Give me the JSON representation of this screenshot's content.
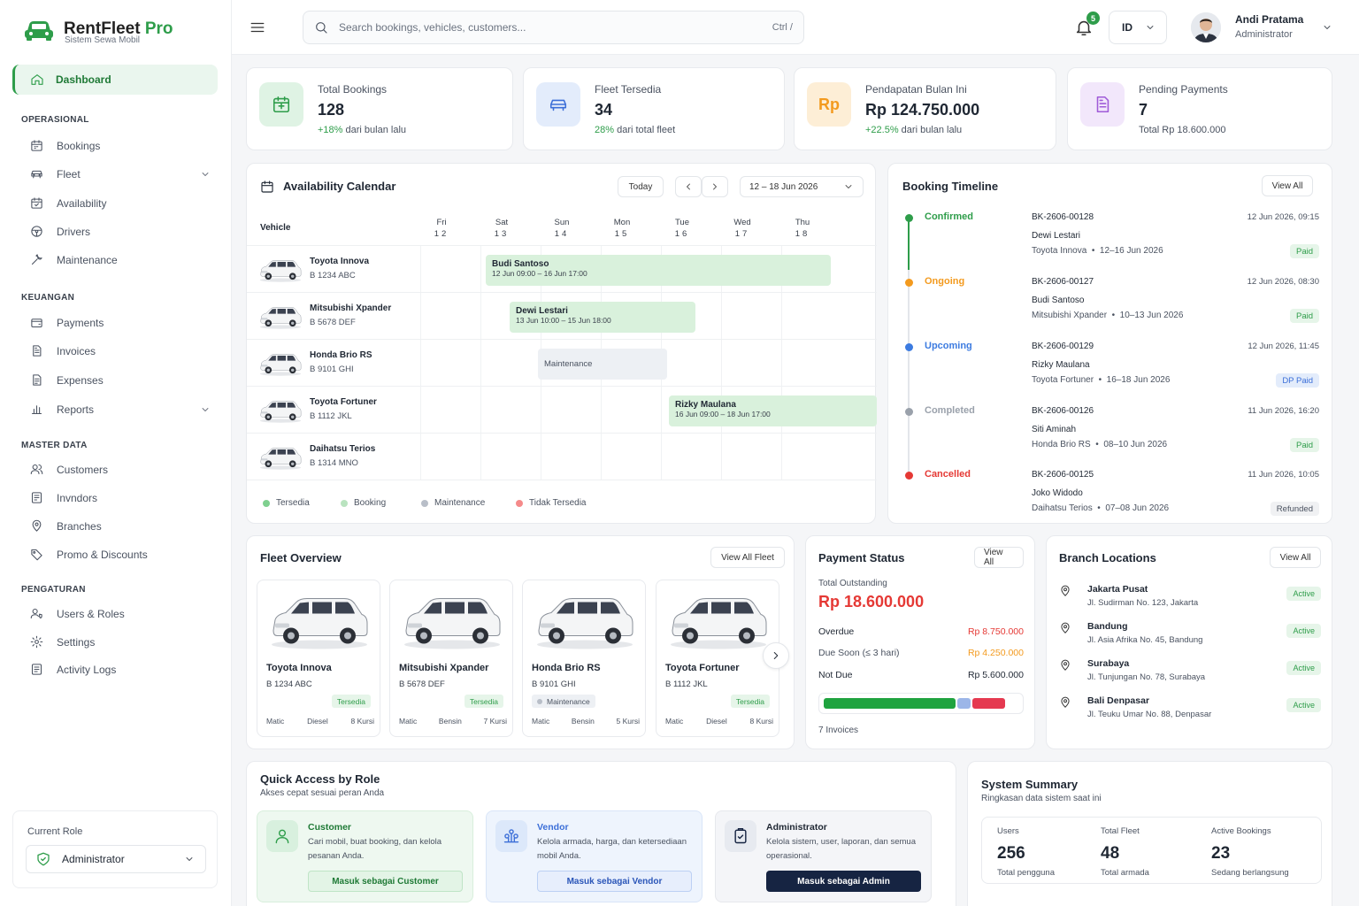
{
  "app": {
    "name": "RentFleet",
    "name_suffix": "Pro",
    "tagline": "Sistem Sewa Mobil"
  },
  "sidebar": {
    "dashboard": "Dashboard",
    "sections": {
      "operasional": "OPERASIONAL",
      "keuangan": "KEUANGAN",
      "master": "MASTER DATA",
      "pengaturan": "PENGATURAN"
    },
    "items": {
      "bookings": "Bookings",
      "fleet": "Fleet",
      "availability": "Availability",
      "drivers": "Drivers",
      "maintenance": "Maintenance",
      "payments": "Payments",
      "invoices": "Invoices",
      "expenses": "Expenses",
      "reports": "Reports",
      "customers": "Customers",
      "invndors": "Invndors",
      "branches": "Branches",
      "promo": "Promo & Discounts",
      "users": "Users & Roles",
      "settings": "Settings",
      "logs": "Activity Logs"
    },
    "role_label": "Current Role",
    "role_value": "Administrator"
  },
  "topbar": {
    "search_placeholder": "Search bookings, vehicles, customers...",
    "search_shortcut": "Ctrl /",
    "notif_count": "5",
    "lang": "ID",
    "user_name": "Andi Pratama",
    "user_role": "Administrator"
  },
  "stats": [
    {
      "title": "Total Bookings",
      "value": "128",
      "sub_hl": "+18%",
      "sub": " dari bulan lalu",
      "icon": "calendar-icon",
      "color": "#2e9d4a",
      "bg": "#dff3e4"
    },
    {
      "title": "Fleet Tersedia",
      "value": "34",
      "sub_hl": "28%",
      "sub": " dari total fleet",
      "icon": "car-icon",
      "color": "#3c6fd8",
      "bg": "#e3ecfb"
    },
    {
      "title": "Pendapatan Bulan Ini",
      "value": "Rp 124.750.000",
      "sub_hl": "+22.5%",
      "sub": " dari bulan lalu",
      "icon": "rupiah-icon",
      "color": "#f39a1e",
      "bg": "#fdeed6"
    },
    {
      "title": "Pending Payments",
      "value": "7",
      "sub_hl": "",
      "sub": "Total Rp 18.600.000",
      "icon": "document-icon",
      "color": "#a05bd8",
      "bg": "#f2e7fb"
    }
  ],
  "calendar": {
    "title": "Availability Calendar",
    "today": "Today",
    "range": "12 – 18 Jun 2026",
    "vehicle_col": "Vehicle",
    "days": [
      {
        "d": "Fri",
        "n": "12"
      },
      {
        "d": "Sat",
        "n": "13"
      },
      {
        "d": "Sun",
        "n": "14"
      },
      {
        "d": "Mon",
        "n": "15"
      },
      {
        "d": "Tue",
        "n": "16"
      },
      {
        "d": "Wed",
        "n": "17"
      },
      {
        "d": "Thu",
        "n": "18"
      }
    ],
    "vehicles": [
      {
        "name": "Toyota Innova",
        "plate": "B 1234 ABC"
      },
      {
        "name": "Mitsubishi Xpander",
        "plate": "B 5678 DEF"
      },
      {
        "name": "Honda Brio RS",
        "plate": "B 9101 GHI"
      },
      {
        "name": "Toyota Fortuner",
        "plate": "B 1112 JKL"
      },
      {
        "name": "Daihatsu Terios",
        "plate": "B 1314 MNO"
      }
    ],
    "bookings": [
      {
        "name": "Budi Santoso",
        "time": "12 Jun 09:00 – 16 Jun 17:00"
      },
      {
        "name": "Dewi Lestari",
        "time": "13 Jun 10:00 – 15 Jun 18:00"
      },
      {
        "name": "Maintenance",
        "time": ""
      },
      {
        "name": "Rizky Maulana",
        "time": "16 Jun 09:00 – 18 Jun 17:00"
      }
    ],
    "legend": [
      {
        "label": "Tersedia",
        "color": "#7fd08f"
      },
      {
        "label": "Booking",
        "color": "#b9e3bf"
      },
      {
        "label": "Maintenance",
        "color": "#b8bec8"
      },
      {
        "label": "Tidak Tersedia",
        "color": "#f58a8a"
      }
    ]
  },
  "timeline": {
    "title": "Booking Timeline",
    "view_all": "View All",
    "items": [
      {
        "status": "Confirmed",
        "color": "#2e9d4a",
        "id": "BK-2606-00128",
        "date": "12 Jun 2026, 09:15",
        "name": "Dewi Lestari",
        "car": "Toyota Innova",
        "period": "12–16 Jun 2026",
        "pay": "Paid",
        "pay_fg": "#2e9d4a",
        "pay_bg": "#e6f5e9"
      },
      {
        "status": "Ongoing",
        "color": "#f39a1e",
        "id": "BK-2606-00127",
        "date": "12 Jun 2026, 08:30",
        "name": "Budi Santoso",
        "car": "Mitsubishi Xpander",
        "period": "10–13 Jun 2026",
        "pay": "Paid",
        "pay_fg": "#2e9d4a",
        "pay_bg": "#e6f5e9"
      },
      {
        "status": "Upcoming",
        "color": "#3c7be0",
        "id": "BK-2606-00129",
        "date": "12 Jun 2026, 11:45",
        "name": "Rizky Maulana",
        "car": "Toyota Fortuner",
        "period": "16–18 Jun 2026",
        "pay": "DP Paid",
        "pay_fg": "#3c6fd8",
        "pay_bg": "#e3ecfb"
      },
      {
        "status": "Completed",
        "color": "#9aa1ab",
        "id": "BK-2606-00126",
        "date": "11 Jun 2026, 16:20",
        "name": "Siti Aminah",
        "car": "Honda Brio RS",
        "period": "08–10 Jun 2026",
        "pay": "Paid",
        "pay_fg": "#2e9d4a",
        "pay_bg": "#e6f5e9"
      },
      {
        "status": "Cancelled",
        "color": "#e53935",
        "id": "BK-2606-00125",
        "date": "11 Jun 2026, 10:05",
        "name": "Joko Widodo",
        "car": "Daihatsu Terios",
        "period": "07–08 Jun 2026",
        "pay": "Refunded",
        "pay_fg": "#4a5260",
        "pay_bg": "#f0f1f3"
      }
    ]
  },
  "fleet": {
    "title": "Fleet Overview",
    "view_all": "View All Fleet",
    "cars": [
      {
        "name": "Toyota Innova",
        "plate": "B 1234 ABC",
        "status": "Tersedia",
        "trans": "Matic",
        "fuel": "Diesel",
        "seats": "8 Kursi"
      },
      {
        "name": "Mitsubishi Xpander",
        "plate": "B 5678 DEF",
        "status": "Tersedia",
        "trans": "Matic",
        "fuel": "Bensin",
        "seats": "7 Kursi"
      },
      {
        "name": "Honda Brio RS",
        "plate": "B 9101 GHI",
        "status": "Maintenance",
        "trans": "Matic",
        "fuel": "Bensin",
        "seats": "5 Kursi"
      },
      {
        "name": "Toyota Fortuner",
        "plate": "B 1112 JKL",
        "status": "Tersedia",
        "trans": "Matic",
        "fuel": "Diesel",
        "seats": "8 Kursi"
      }
    ]
  },
  "payment": {
    "title": "Payment Status",
    "view_all": "View All",
    "outstanding_label": "Total Outstanding",
    "outstanding": "Rp 18.600.000",
    "rows": [
      {
        "label": "Overdue",
        "value": "Rp 8.750.000",
        "color": "#e53935"
      },
      {
        "label": "Due Soon (≤ 3 hari)",
        "value": "Rp 4.250.000",
        "color": "#f39a1e"
      },
      {
        "label": "Not Due",
        "value": "Rp 5.600.000",
        "color": "#1f2733"
      }
    ],
    "bar": [
      {
        "share": 0.69,
        "color": "#1fa33f"
      },
      {
        "share": 0.07,
        "color": "#9cb6e8"
      },
      {
        "share": 0.17,
        "color": "#e53950"
      }
    ],
    "invoices": "7 Invoices"
  },
  "branches": {
    "title": "Branch Locations",
    "view_all": "View All",
    "items": [
      {
        "name": "Jakarta Pusat",
        "addr": "Jl. Sudirman No. 123, Jakarta",
        "status": "Active"
      },
      {
        "name": "Bandung",
        "addr": "Jl. Asia Afrika No. 45, Bandung",
        "status": "Active"
      },
      {
        "name": "Surabaya",
        "addr": "Jl. Tunjungan No. 78, Surabaya",
        "status": "Active"
      },
      {
        "name": "Bali Denpasar",
        "addr": "Jl. Teuku Umar No. 88, Denpasar",
        "status": "Active"
      }
    ]
  },
  "quick": {
    "title": "Quick Access by Role",
    "subtitle": "Akses cepat sesuai peran Anda",
    "roles": [
      {
        "title": "Customer",
        "desc": "Cari mobil, buat booking, dan kelola pesanan Anda.",
        "btn": "Masuk sebagai Customer"
      },
      {
        "title": "Vendor",
        "desc": "Kelola armada, harga, dan ketersediaan mobil Anda.",
        "btn": "Masuk sebagai Vendor"
      },
      {
        "title": "Administrator",
        "desc": "Kelola sistem, user, laporan, dan semua operasional.",
        "btn": "Masuk sebagai Admin"
      }
    ]
  },
  "summary": {
    "title": "System Summary",
    "subtitle": "Ringkasan data sistem saat ini",
    "items": [
      {
        "label": "Users",
        "value": "256",
        "sub": "Total pengguna"
      },
      {
        "label": "Total Fleet",
        "value": "48",
        "sub": "Total armada"
      },
      {
        "label": "Active Bookings",
        "value": "23",
        "sub": "Sedang berlangsung"
      }
    ]
  },
  "colors": {
    "brand": "#2e9d4a",
    "navy": "#162442"
  }
}
